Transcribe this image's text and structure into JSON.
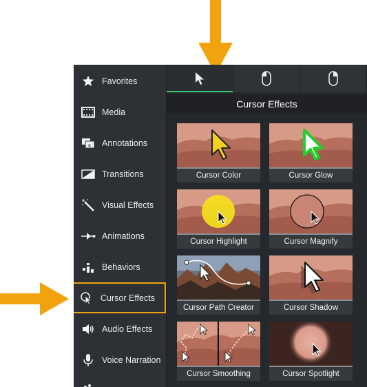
{
  "sidebar": {
    "items": [
      {
        "label": "Favorites",
        "icon": "star-icon"
      },
      {
        "label": "Media",
        "icon": "film-icon"
      },
      {
        "label": "Annotations",
        "icon": "annotation-icon"
      },
      {
        "label": "Transitions",
        "icon": "transition-icon"
      },
      {
        "label": "Visual Effects",
        "icon": "magic-wand-icon"
      },
      {
        "label": "Animations",
        "icon": "animation-arrow-icon"
      },
      {
        "label": "Behaviors",
        "icon": "behaviors-icon"
      },
      {
        "label": "Cursor Effects",
        "icon": "cursor-effects-icon",
        "selected": true
      },
      {
        "label": "Audio Effects",
        "icon": "speaker-icon"
      },
      {
        "label": "Voice Narration",
        "icon": "microphone-icon"
      }
    ]
  },
  "tabs": [
    {
      "icon": "cursor-arrow-icon",
      "active": true
    },
    {
      "icon": "left-click-mouse-icon"
    },
    {
      "icon": "right-click-mouse-icon"
    }
  ],
  "section_title": "Cursor Effects",
  "effects": [
    {
      "label": "Cursor Color"
    },
    {
      "label": "Cursor Glow"
    },
    {
      "label": "Cursor Highlight"
    },
    {
      "label": "Cursor Magnify"
    },
    {
      "label": "Cursor Path Creator"
    },
    {
      "label": "Cursor Shadow"
    },
    {
      "label": "Cursor Smoothing"
    },
    {
      "label": "Cursor Spotlight"
    }
  ],
  "colors": {
    "accent": "#f2a20c",
    "active_tab": "#3fc46f",
    "panel": "#2a2d31"
  }
}
